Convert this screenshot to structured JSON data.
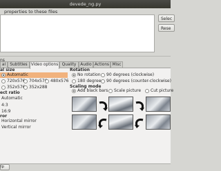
{
  "window": {
    "title": "devede_ng.py"
  },
  "files_heading": "properties to these files",
  "side_buttons": {
    "select": "Selec",
    "reset": "Rese"
  },
  "left_stub": "ns",
  "tabs": [
    {
      "label": "al",
      "active": false
    },
    {
      "label": "Subtitles",
      "active": false
    },
    {
      "label": "Video options",
      "active": true
    },
    {
      "label": "Quality",
      "active": false
    },
    {
      "label": "Audio",
      "active": false
    },
    {
      "label": "Actions",
      "active": false
    },
    {
      "label": "Misc",
      "active": false
    }
  ],
  "final_size": {
    "heading": "al size",
    "options": [
      "Automatic",
      "720x576",
      "704x576",
      "480x576",
      "352x576",
      "352x288"
    ],
    "selected": "Automatic"
  },
  "aspect_ratio": {
    "heading": "ect ratio",
    "options": [
      "Automatic",
      "4:3",
      "16:9"
    ]
  },
  "mirror": {
    "heading": "ror",
    "options": [
      "Horizontal mirror",
      "Vertical mirror"
    ]
  },
  "rotation": {
    "heading": "Rotation",
    "options": [
      "No rotation",
      "90 degrees (clockwise)",
      "180 degrees",
      "90 degrees (counter-clockwise)"
    ],
    "selected": "No rotation"
  },
  "scaling": {
    "heading": "Scaling mode",
    "options": [
      "Add black bars",
      "Scale picture",
      "Cut picture"
    ],
    "selected": "Add black bars"
  },
  "bottom": {
    "help": "lp"
  },
  "colors": {
    "highlight": "#f1b27d",
    "titlebar": "#3c3b37"
  }
}
